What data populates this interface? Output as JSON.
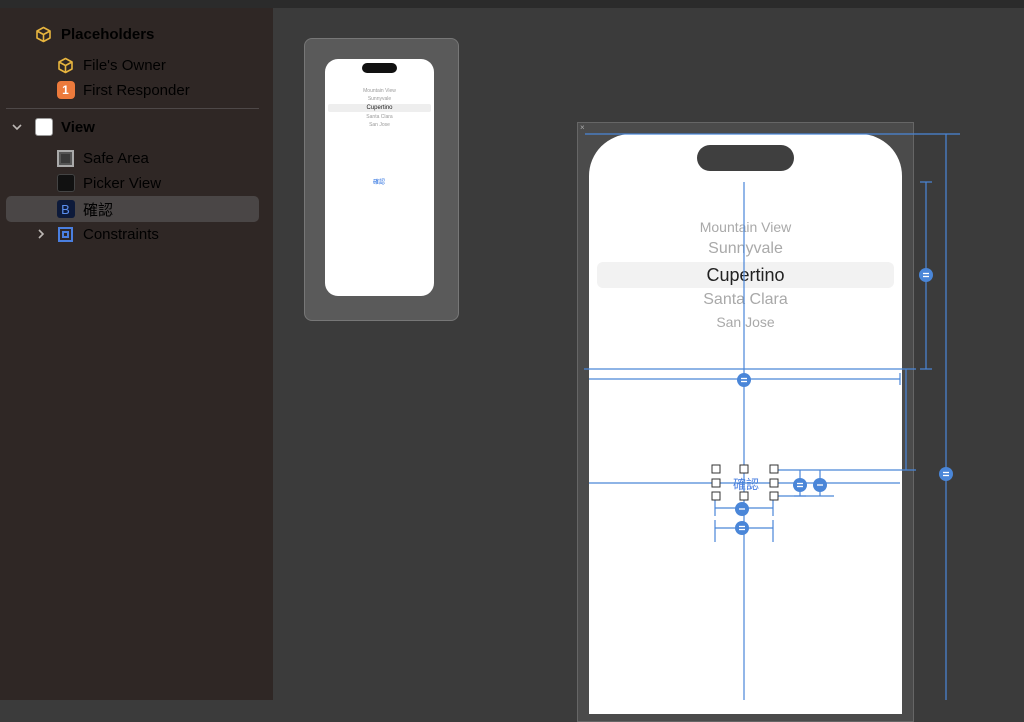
{
  "outline": {
    "placeholders": {
      "label": "Placeholders"
    },
    "files_owner": {
      "label": "File's Owner"
    },
    "first_responder": {
      "label": "First Responder",
      "badge": "1"
    },
    "view": {
      "label": "View"
    },
    "safe_area": {
      "label": "Safe Area"
    },
    "picker_view": {
      "label": "Picker View"
    },
    "confirm_button": {
      "label": "確認",
      "badge": "B"
    },
    "constraints": {
      "label": "Constraints"
    }
  },
  "picker": {
    "items": [
      "Mountain View",
      "Sunnyvale",
      "Cupertino",
      "Santa Clara",
      "San Jose"
    ],
    "selected": "Cupertino"
  },
  "button": {
    "label": "確認"
  },
  "colors": {
    "accent": "#4a86d8",
    "placeholder_icon": "#e8b53e",
    "first_responder": "#ec7a3c",
    "button_badge": "#1f4fbf"
  }
}
